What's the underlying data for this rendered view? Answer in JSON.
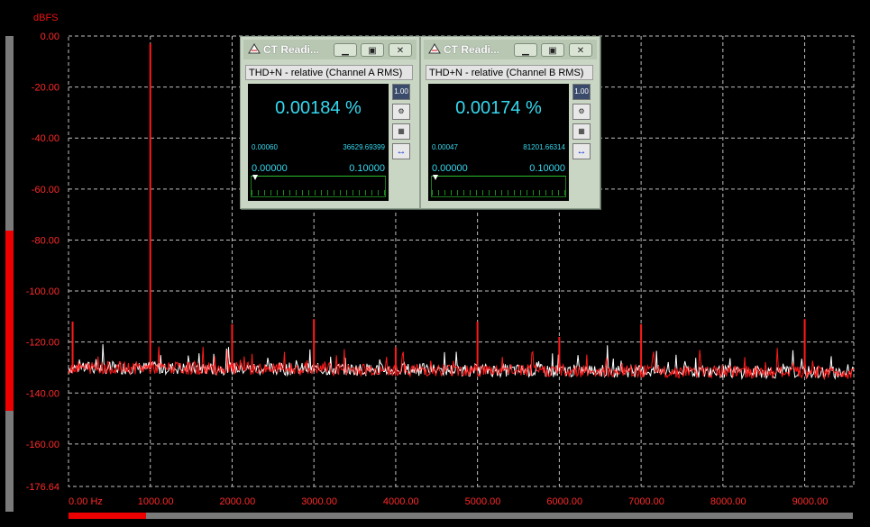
{
  "plot": {
    "y_unit": "dBFS",
    "y_ticks": [
      "0.00",
      "-20.00",
      "-40.00",
      "-60.00",
      "-80.00",
      "-100.00",
      "-120.00",
      "-140.00",
      "-160.00",
      "-176.64"
    ],
    "y_values": [
      0,
      -20,
      -40,
      -60,
      -80,
      -100,
      -120,
      -140,
      -160,
      -176.64
    ],
    "x_ticks": [
      "0.00 Hz",
      "1000.00",
      "2000.00",
      "3000.00",
      "4000.00",
      "5000.00",
      "6000.00",
      "7000.00",
      "8000.00",
      "9000.00"
    ],
    "x_values": [
      0,
      1000,
      2000,
      3000,
      4000,
      5000,
      6000,
      7000,
      8000,
      9000
    ],
    "x_range": [
      0,
      9600
    ],
    "y_range": [
      -176.64,
      0
    ],
    "noise_floor_db": -130,
    "peaks": [
      {
        "freq": 50,
        "db": -112
      },
      {
        "freq": 1000,
        "db": -3
      },
      {
        "freq": 2000,
        "db": -113
      },
      {
        "freq": 3000,
        "db": -111
      },
      {
        "freq": 4000,
        "db": -122
      },
      {
        "freq": 5000,
        "db": -112
      },
      {
        "freq": 6000,
        "db": -118
      },
      {
        "freq": 7000,
        "db": -113
      },
      {
        "freq": 9000,
        "db": -111
      }
    ],
    "colors": {
      "trace_a": "#ff1a1a",
      "trace_b": "#ffffff",
      "grid": "#bfbfbf",
      "labels": "#ff2a2a"
    }
  },
  "windows": [
    {
      "title": "CT Readi...",
      "label": "THD+N - relative (Channel A RMS)",
      "reading": "0.00184 %",
      "range_lo": "0.00060",
      "range_hi": "36629.69399",
      "scale_lo": "0.00000",
      "scale_hi": "0.10000"
    },
    {
      "title": "CT Readi...",
      "label": "THD+N - relative (Channel B RMS)",
      "reading": "0.00174 %",
      "range_lo": "0.00047",
      "range_hi": "81201.66314",
      "scale_lo": "0.00000",
      "scale_hi": "0.10000"
    }
  ],
  "icons": {
    "minimize": "minimize-icon",
    "restore": "restore-icon",
    "close": "close-icon",
    "meter": "meter-icon",
    "settings": "settings-icon",
    "calculator": "calculator-icon",
    "arrows": "left-right-arrows-icon"
  },
  "side_button_text": "1.00"
}
